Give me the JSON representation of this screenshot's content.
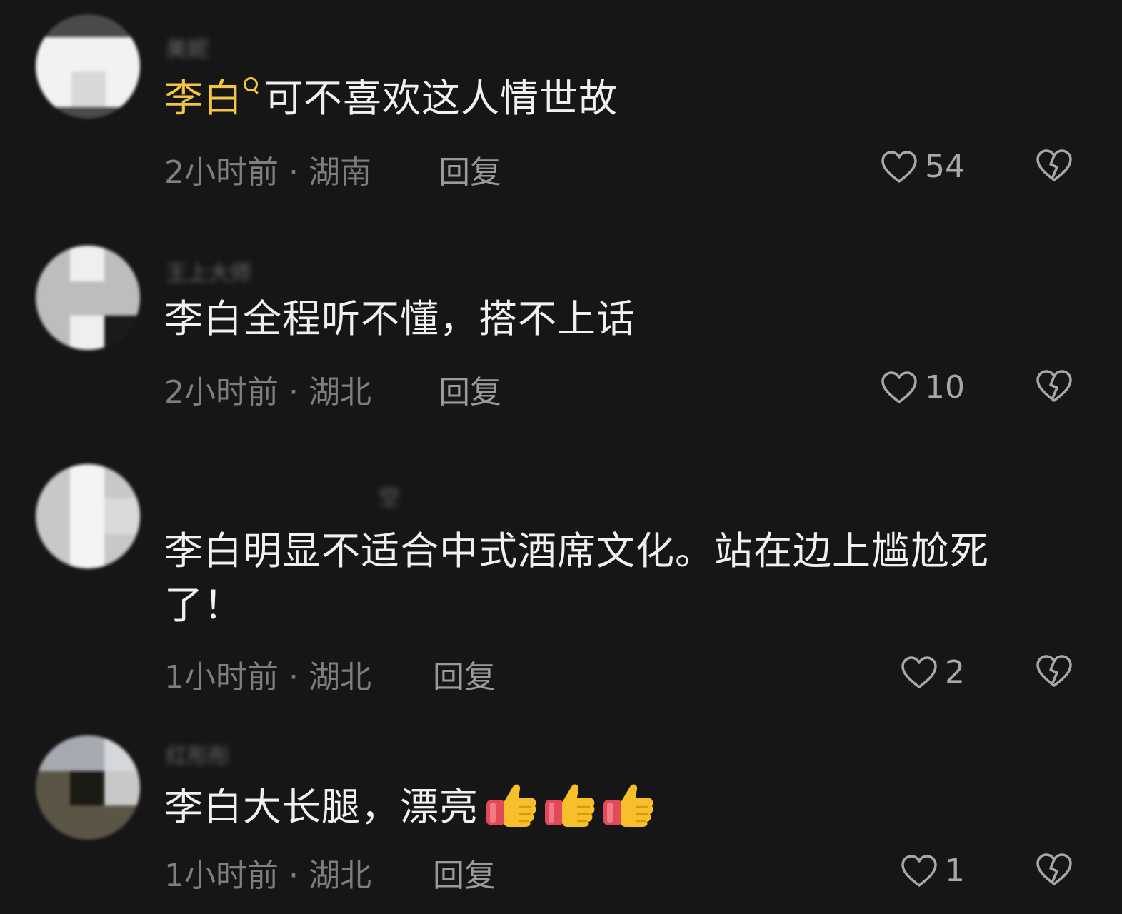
{
  "colors": {
    "background": "#161616",
    "text": "#f0f0f0",
    "meta": "#7e7e7e",
    "highlight": "#f4c542"
  },
  "comments": [
    {
      "username": "美妮",
      "highlight": "李白",
      "highlight_icon": "search-icon",
      "text": "可不喜欢这人情世故",
      "time_location": "2小时前 · 湖南",
      "reply": "回复",
      "likes": "54"
    },
    {
      "username": "王上大师",
      "text": "李白全程听不懂，搭不上话",
      "time_location": "2小时前 · 湖北",
      "reply": "回复",
      "likes": "10"
    },
    {
      "username": "空",
      "text": "李白明显不适合中式酒席文化。站在边上尴尬死了！",
      "time_location": "1小时前 · 湖北",
      "reply": "回复",
      "likes": "2"
    },
    {
      "username": "红彤彤",
      "text": "李白大长腿，漂亮",
      "emoji": "thumbs-up-emoji",
      "emoji_count": 3,
      "time_location": "1小时前 · 湖北",
      "reply": "回复",
      "likes": "1"
    }
  ]
}
